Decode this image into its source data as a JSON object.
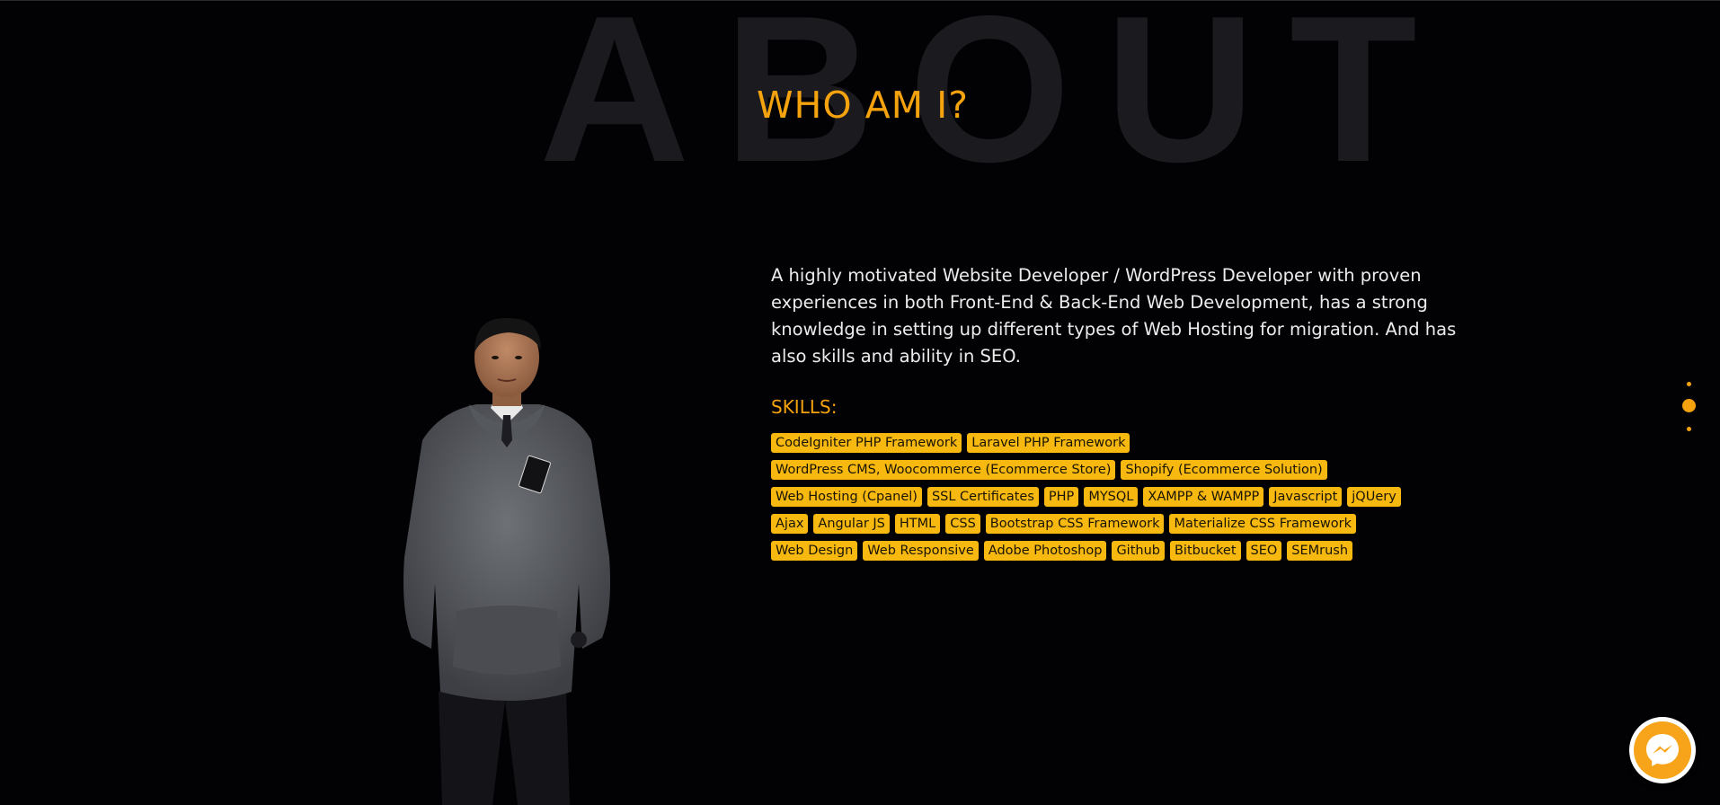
{
  "colors": {
    "background": "#020204",
    "accent": "#f5a20f",
    "chip_background": "#f7b90f",
    "chip_text": "#1a1405"
  },
  "section": {
    "background_word": "ABOUT",
    "title": "WHO AM I?"
  },
  "bio": {
    "text": "A highly motivated Website Developer / WordPress Developer with proven experiences in both Front-End & Back-End Web Development, has a strong knowledge in setting up different types of Web Hosting for migration. And has also skills and ability in SEO."
  },
  "skills": {
    "heading": "SKILLS:",
    "rows": [
      [
        "CodeIgniter PHP Framework",
        "Laravel PHP Framework"
      ],
      [
        "WordPress CMS, Woocommerce (Ecommerce Store)",
        "Shopify (Ecommerce Solution)"
      ],
      [
        "Web Hosting (Cpanel)",
        "SSL Certificates",
        "PHP",
        "MYSQL",
        "XAMPP & WAMPP",
        "Javascript",
        "jQUery"
      ],
      [
        "Ajax",
        "Angular JS",
        "HTML",
        "CSS",
        "Bootstrap CSS Framework",
        "Materialize CSS Framework"
      ],
      [
        "Web Design",
        "Web Responsive",
        "Adobe Photoshop",
        "Github",
        "Bitbucket",
        "SEO",
        "SEMrush"
      ]
    ]
  },
  "page_nav": {
    "dots": 3,
    "active_index": 1
  },
  "icons": {
    "portrait": "person-photo",
    "chat": "messenger-icon"
  }
}
